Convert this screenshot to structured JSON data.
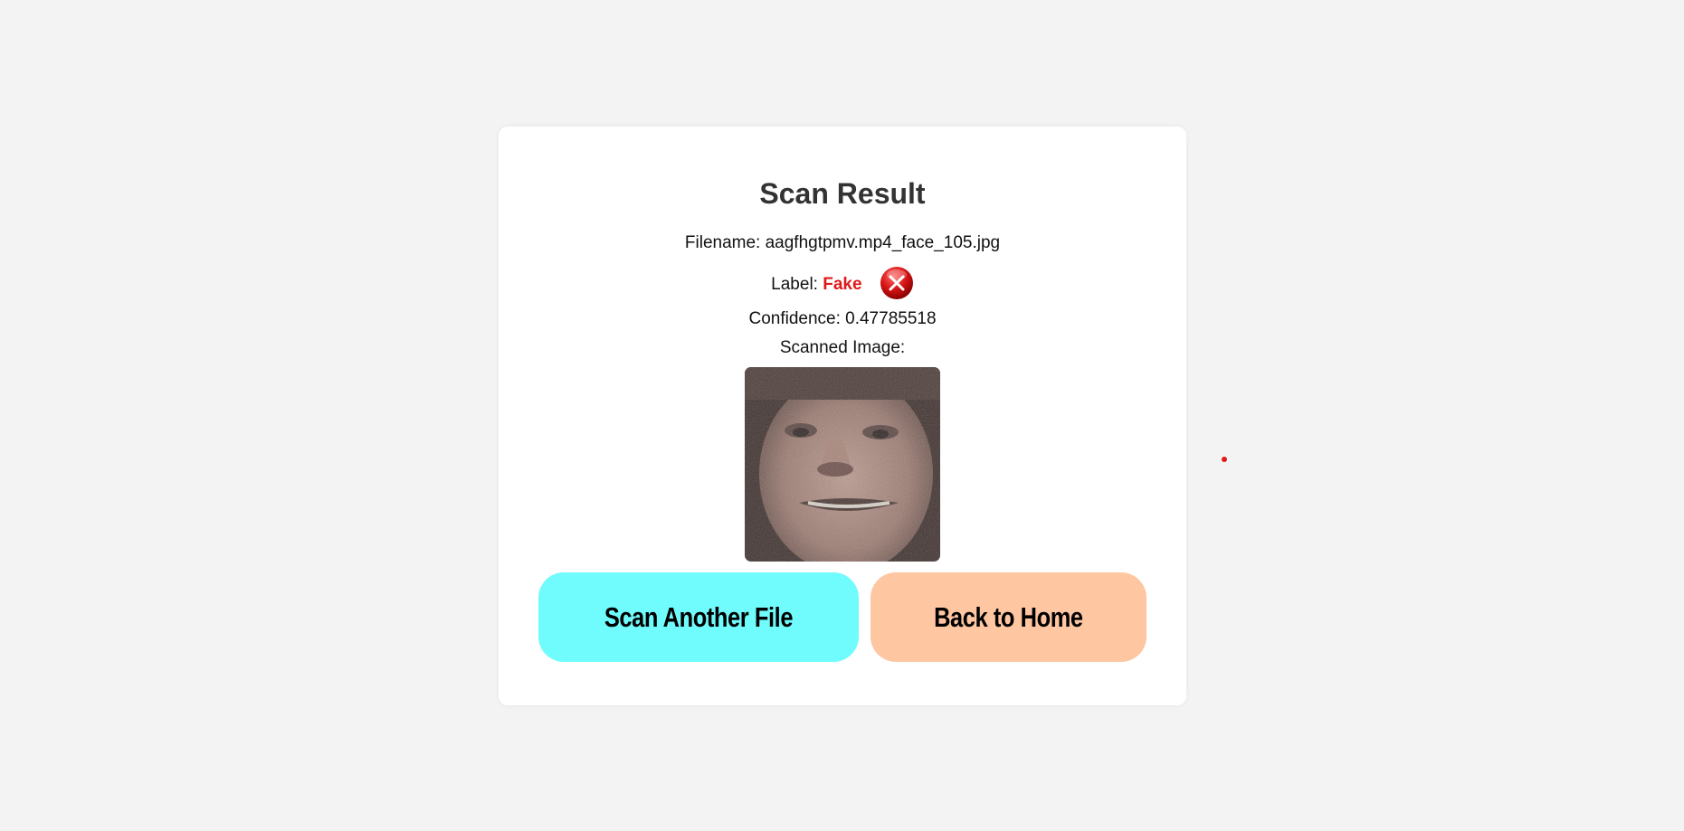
{
  "result": {
    "title": "Scan Result",
    "filename_text": "Filename: aagfhgtpmv.mp4_face_105.jpg",
    "label_prefix": "Label: ",
    "label_value": "Fake",
    "label_icon": "error-x-icon",
    "confidence_text": "Confidence: 0.47785518",
    "scanned_image_label": "Scanned Image:"
  },
  "buttons": {
    "scan_another": "Scan Another File",
    "back_home": "Back to Home"
  },
  "colors": {
    "page_bg": "#f3f3f3",
    "card_bg": "#ffffff",
    "fake_label": "#e01818",
    "scan_button": "#70fbfd",
    "home_button": "#ffc6a2"
  }
}
